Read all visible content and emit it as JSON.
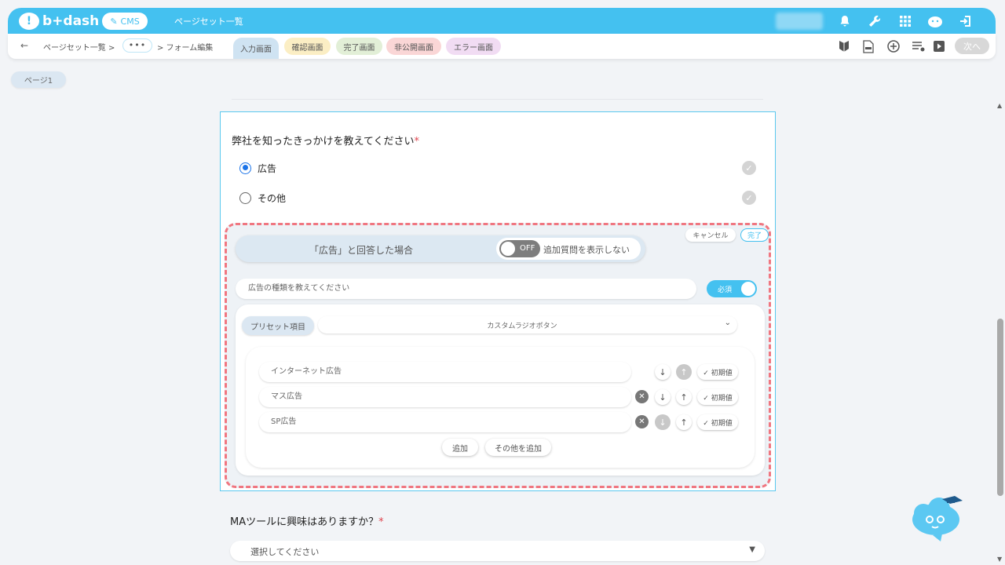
{
  "header": {
    "logo_text": "b+dash",
    "logo_mark": "!",
    "cms_label": "CMS",
    "title": "ページセット一覧",
    "icons": [
      "bell-icon",
      "wrench-icon",
      "grid-icon",
      "mascot-icon",
      "logout-icon"
    ]
  },
  "subbar": {
    "back_glyph": "←",
    "breadcrumb_1": "ページセット一覧 >",
    "breadcrumb_dots": "•••",
    "breadcrumb_2": "> フォーム編集",
    "tabs": [
      {
        "label": "入力画面",
        "color": "#cfe3f2",
        "active": true
      },
      {
        "label": "確認画面",
        "color": "#fbeec4"
      },
      {
        "label": "完了画面",
        "color": "#e2efd7"
      },
      {
        "label": "非公開画面",
        "color": "#fad6d6"
      },
      {
        "label": "エラー画面",
        "color": "#f1dcf3"
      }
    ],
    "tool_icons": [
      "badge-icon",
      "html-file-icon",
      "add-circle-icon",
      "list-settings-icon",
      "play-icon"
    ],
    "next_label": "次へ"
  },
  "page_tab": "ページ1",
  "question1": {
    "title": "弊社を知ったきっかけを教えてください",
    "required_mark": "*",
    "options": [
      {
        "label": "広告",
        "selected": true
      },
      {
        "label": "その他",
        "selected": false
      }
    ],
    "check_glyph": "✓"
  },
  "conditional": {
    "condition_text": "「広告」と回答した場合",
    "toggle_state": "OFF",
    "toggle_label": "追加質問を表示しない",
    "cancel_label": "キャンセル",
    "done_label": "完了",
    "sub_question_placeholder": "広告の種類を教えてください",
    "required_toggle_label": "必須",
    "preset_label": "プリセット項目",
    "preset_value": "カスタムラジオボタン",
    "choices": [
      {
        "value": "インターネット広告",
        "deletable": false,
        "down_enabled": true,
        "up_enabled": false
      },
      {
        "value": "マス広告",
        "deletable": true,
        "down_enabled": true,
        "up_enabled": true
      },
      {
        "value": "SP広告",
        "deletable": true,
        "down_enabled": false,
        "up_enabled": true
      }
    ],
    "default_label": "✓ 初期値",
    "delete_glyph": "✕",
    "down_glyph": "↓",
    "up_glyph": "↑",
    "add_label": "追加",
    "add_other_label": "その他を追加"
  },
  "question2": {
    "title": "MAツールに興味はありますか？",
    "required_mark": "*",
    "select_placeholder": "選択してください"
  },
  "colors": {
    "accent": "#44c1f0",
    "dashed_border": "#f07680",
    "radio_selected": "#1a73e8",
    "required": "#e0444e"
  }
}
